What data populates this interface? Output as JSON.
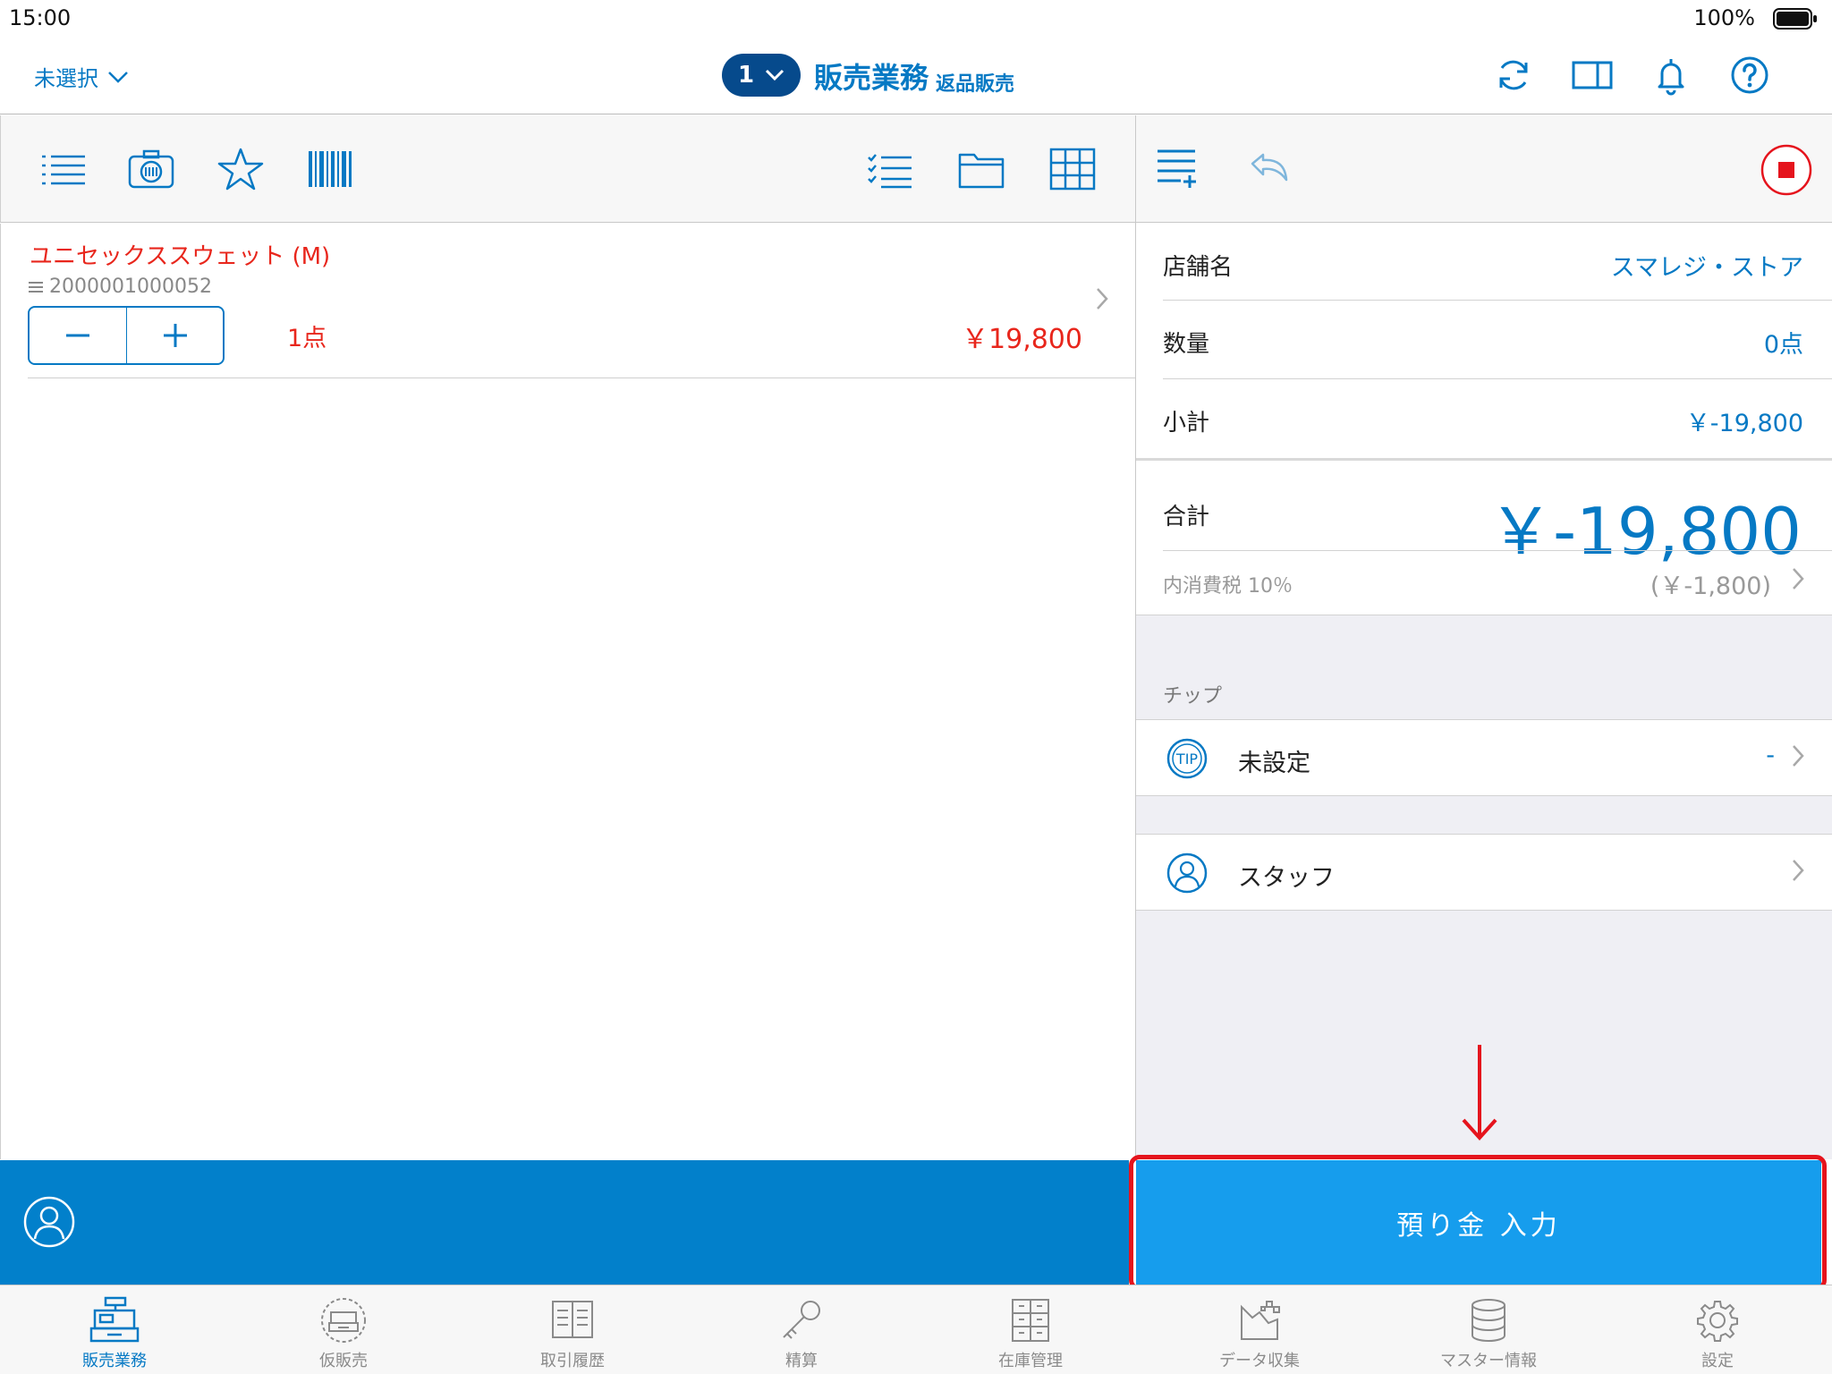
{
  "status_bar": {
    "time": "15:00",
    "battery": "100%"
  },
  "nav": {
    "store_selector": "未選択",
    "register_number": "1",
    "title": "販売業務",
    "subtitle": "返品販売"
  },
  "cart": {
    "items": [
      {
        "name": "ユニセックススウェット (M)",
        "code": "2000001000052",
        "quantity": "1点",
        "price": "￥19,800"
      }
    ]
  },
  "summary": {
    "store_label": "店舗名",
    "store_value": "スマレジ・ストア",
    "quantity_label": "数量",
    "quantity_value": "0点",
    "subtotal_label": "小計",
    "subtotal_value": "￥-19,800",
    "total_label": "合計",
    "total_value": "￥-19,800",
    "tax_label": "内消費税 10％",
    "tax_value": "(￥-1,800)"
  },
  "tip": {
    "header": "チップ",
    "label": "未設定",
    "value": "-",
    "icon_text": "TIP"
  },
  "staff": {
    "label": "スタッフ"
  },
  "deposit_button": "預り金 入力",
  "tabs": [
    {
      "label": "販売業務",
      "icon": "register-icon",
      "active": true
    },
    {
      "label": "仮販売",
      "icon": "temp-sale-icon"
    },
    {
      "label": "取引履歴",
      "icon": "history-icon"
    },
    {
      "label": "精算",
      "icon": "key-icon"
    },
    {
      "label": "在庫管理",
      "icon": "inventory-icon"
    },
    {
      "label": "データ収集",
      "icon": "data-collection-icon"
    },
    {
      "label": "マスター情報",
      "icon": "database-icon"
    },
    {
      "label": "設定",
      "icon": "gear-icon"
    }
  ],
  "colors": {
    "accent": "#0679c4",
    "cart_red": "#e8261c",
    "button_blue": "#169ded",
    "bar_blue": "#0280cb",
    "highlight": "#e5141d"
  }
}
